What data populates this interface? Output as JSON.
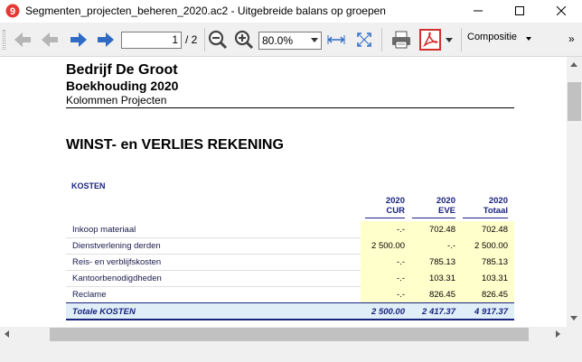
{
  "window": {
    "title": "Segmenten_projecten_beheren_2020.ac2 - Uitgebreide balans op groepen"
  },
  "toolbar": {
    "page_current": "1",
    "page_total": "/ 2",
    "zoom": "80.0%",
    "composition_label": "Compositie",
    "overflow": "»"
  },
  "report": {
    "company": "Bedrijf De Groot",
    "book": "Boekhouding 2020",
    "subtitle": "Kolommen Projecten",
    "title": "WINST- en VERLIES REKENING",
    "section": "KOSTEN",
    "columns": [
      {
        "year": "2020",
        "code": "CUR"
      },
      {
        "year": "2020",
        "code": "EVE"
      },
      {
        "year": "2020",
        "code": "Totaal"
      }
    ],
    "rows": [
      {
        "label": "Inkoop materiaal",
        "cur": "-.-",
        "eve": "702.48",
        "total": "702.48"
      },
      {
        "label": "Dienstverlening derden",
        "cur": "2 500.00",
        "eve": "-.-",
        "total": "2 500.00"
      },
      {
        "label": "Reis- en verblijfskosten",
        "cur": "-.-",
        "eve": "785.13",
        "total": "785.13"
      },
      {
        "label": "Kantoorbenodigdheden",
        "cur": "-.-",
        "eve": "103.31",
        "total": "103.31"
      },
      {
        "label": "Reclame",
        "cur": "-.-",
        "eve": "826.45",
        "total": "826.45"
      }
    ],
    "total": {
      "label": "Totale KOSTEN",
      "cur": "2 500.00",
      "eve": "2 417.37",
      "total": "4 917.37"
    }
  },
  "colors": {
    "accent_blue": "#1a237e",
    "highlight_yellow": "#ffffcc",
    "total_bg": "#dfeef7",
    "nav_arrow_active": "#2f6bc4",
    "pdf_red": "#d32f2f"
  }
}
